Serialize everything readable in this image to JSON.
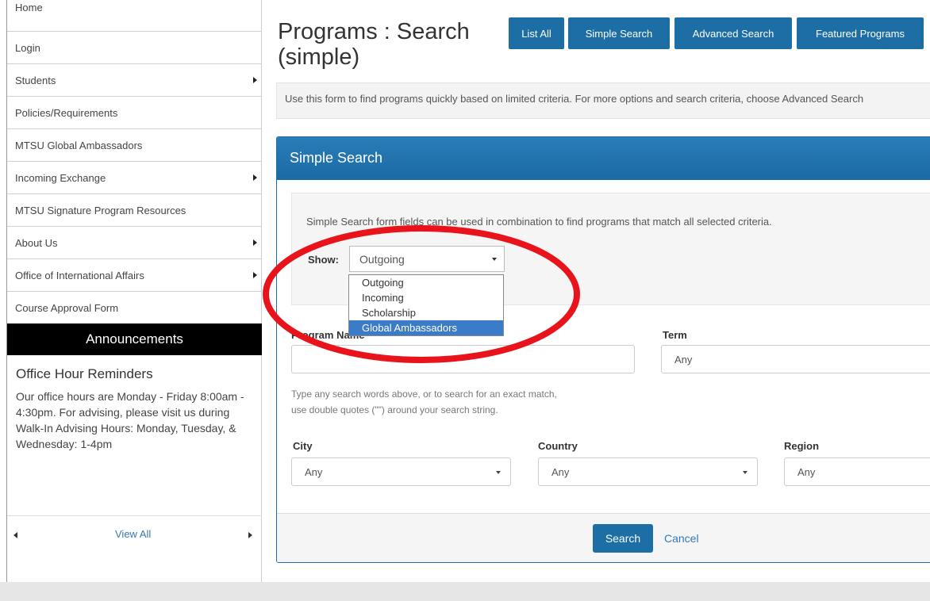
{
  "sidebar": {
    "items": [
      {
        "label": "Home",
        "has_submenu": false
      },
      {
        "label": "Login",
        "has_submenu": false
      },
      {
        "label": "Students",
        "has_submenu": true
      },
      {
        "label": "Policies/Requirements",
        "has_submenu": false
      },
      {
        "label": "MTSU Global Ambassadors",
        "has_submenu": false
      },
      {
        "label": "Incoming Exchange",
        "has_submenu": true
      },
      {
        "label": "MTSU Signature Program Resources",
        "has_submenu": false
      },
      {
        "label": "About Us",
        "has_submenu": true
      },
      {
        "label": "Office of International Affairs",
        "has_submenu": true
      },
      {
        "label": "Course Approval Form",
        "has_submenu": false
      }
    ],
    "announcements": {
      "header": "Announcements",
      "title": "Office Hour Reminders",
      "text": "Our office hours are Monday - Friday 8:00am - 4:30pm. For advising, please visit us during Walk-In Advising Hours: Monday, Tuesday, & Wednesday: 1-4pm",
      "view_all": "View All"
    }
  },
  "header": {
    "title": "Programs : Search (simple)",
    "buttons": {
      "list_all": "List All",
      "simple_search": "Simple Search",
      "advanced_search": "Advanced Search",
      "featured_programs": "Featured Programs"
    },
    "info": "Use this form to find programs quickly based on limited criteria. For more options and search criteria, choose Advanced Search"
  },
  "panel": {
    "title": "Simple Search",
    "intro": "Simple Search form fields can be used in combination to find programs that match all selected criteria.",
    "show": {
      "label": "Show:",
      "value": "Outgoing",
      "options": [
        "Outgoing",
        "Incoming",
        "Scholarship",
        "Global Ambassadors"
      ],
      "highlighted": "Global Ambassadors"
    },
    "program_name": {
      "label": "Program Name",
      "value": ""
    },
    "term": {
      "label": "Term",
      "value": "Any"
    },
    "help": {
      "line1": "Type any search words above, or to search for an exact match,",
      "line2": "use double quotes (\"\") around your search string."
    },
    "city": {
      "label": "City",
      "value": "Any"
    },
    "country": {
      "label": "Country",
      "value": "Any"
    },
    "region": {
      "label": "Region",
      "value": "Any"
    },
    "search_button": "Search",
    "cancel_link": "Cancel"
  },
  "colors": {
    "primary": "#1c6ea4",
    "highlight_ellipse": "#e8131b",
    "selected_option": "#3a7cc8"
  }
}
